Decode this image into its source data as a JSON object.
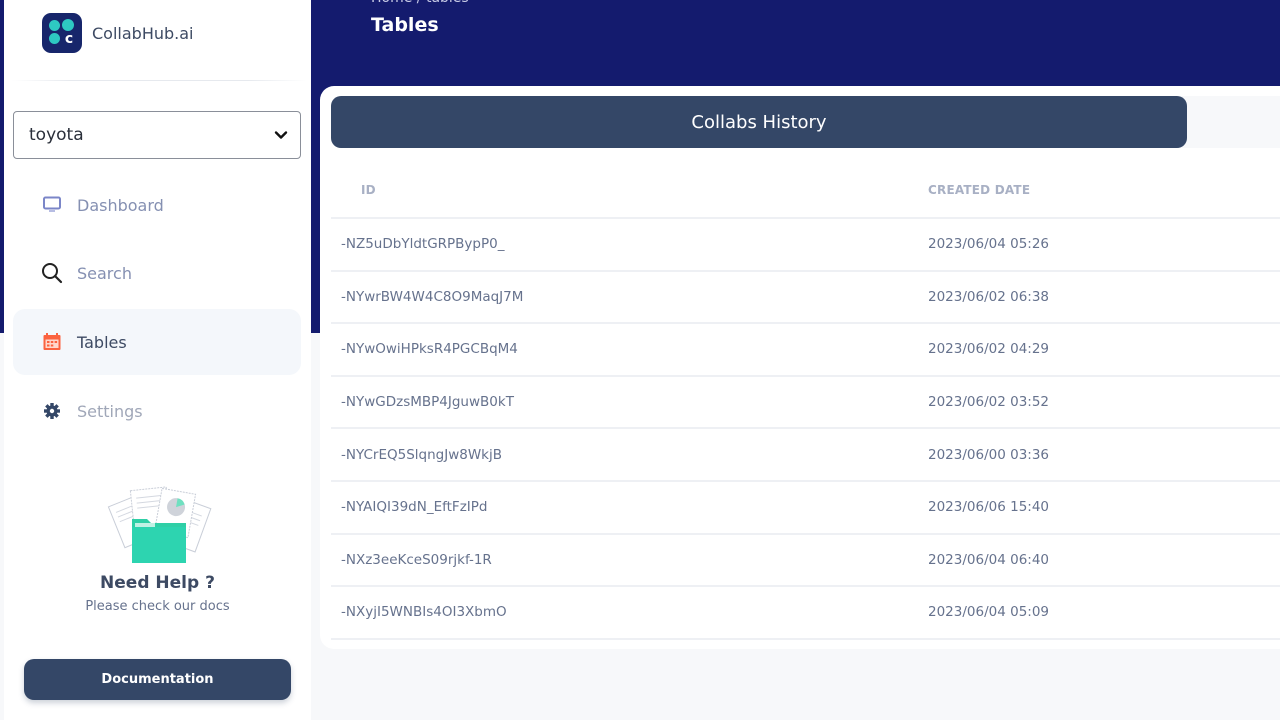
{
  "brand": {
    "name": "CollabHub.ai",
    "logo_letter": "c"
  },
  "org_selector": {
    "value": "toyota"
  },
  "sidebar": {
    "items": [
      {
        "label": "Dashboard",
        "icon": "monitor-icon",
        "active": false
      },
      {
        "label": "Search",
        "icon": "search-icon",
        "active": false
      },
      {
        "label": "Tables",
        "icon": "calendar-icon",
        "active": true
      },
      {
        "label": "Settings",
        "icon": "gear-icon",
        "active": false
      }
    ]
  },
  "help": {
    "title": "Need Help ?",
    "subtitle": "Please check our docs",
    "button_label": "Documentation"
  },
  "header": {
    "breadcrumb": "Home  /  tables",
    "title": "Tables"
  },
  "card": {
    "tab_label": "Collabs History",
    "columns": [
      "ID",
      "CREATED DATE"
    ],
    "rows": [
      {
        "id": "-NZ5uDbYldtGRPBypP0_",
        "created": "2023/06/04 05:26"
      },
      {
        "id": "-NYwrBW4W4C8O9MaqJ7M",
        "created": "2023/06/02 06:38"
      },
      {
        "id": "-NYwOwiHPksR4PGCBqM4",
        "created": "2023/06/02 04:29"
      },
      {
        "id": "-NYwGDzsMBP4JguwB0kT",
        "created": "2023/06/02 03:52"
      },
      {
        "id": "-NYCrEQ5SlqngJw8WkjB",
        "created": "2023/06/00 03:36"
      },
      {
        "id": "-NYAIQI39dN_EftFzIPd",
        "created": "2023/06/06 15:40"
      },
      {
        "id": "-NXz3eeKceS09rjkf-1R",
        "created": "2023/06/04 06:40"
      },
      {
        "id": "-NXyjI5WNBIs4OI3XbmO",
        "created": "2023/06/04 05:09"
      }
    ]
  },
  "colors": {
    "navy": "#141b6e",
    "primary": "#344767",
    "active_icon": "#fb6340",
    "teal": "#2ec9c2"
  }
}
